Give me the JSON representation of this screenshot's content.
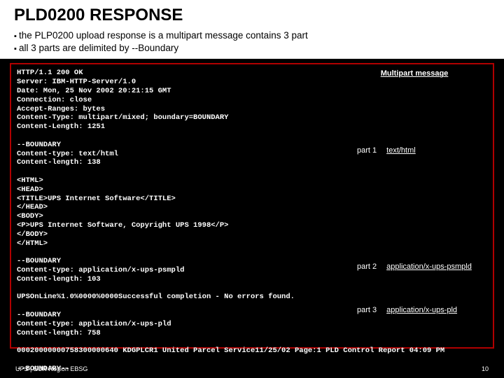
{
  "title": "PLD0200 RESPONSE",
  "bullets": [
    "the PLP0200 upload response is a multipart message contains 3 part",
    "all 3 parts are delimited by --Boundary"
  ],
  "labels": {
    "header": "Multipart message",
    "p1": {
      "part": "part 1",
      "type": "text/html"
    },
    "p2": {
      "part": "part 2",
      "type": "application/x-ups-psmpld"
    },
    "p3": {
      "part": "part 3",
      "type": "application/x-ups-pld"
    }
  },
  "code": "HTTP/1.1 200 OK\nServer: IBM-HTTP-Server/1.0\nDate: Mon, 25 Nov 2002 20:21:15 GMT\nConnection: close\nAccept-Ranges: bytes\nContent-Type: multipart/mixed; boundary=BOUNDARY\nContent-Length: 1251\n\n--BOUNDARY\nContent-type: text/html\nContent-length: 138\n\n<HTML>\n<HEAD>\n<TITLE>UPS Internet Software</TITLE>\n</HEAD>\n<BODY>\n<P>UPS Internet Software, Copyright UPS 1998</P>\n</BODY>\n</HTML>\n\n--BOUNDARY\nContent-type: application/x-ups-psmpld\nContent-length: 103\n\nUPSOnLine%1.0%0000%0000Successful completion - No errors found.\n\n--BOUNDARY\nContent-type: application/x-ups-pld\nContent-length: 758\n\n00020000000758300000640 KDGPLCR1 United Parcel Service11/25/02 Page:1 PLD Control Report 04:09 PM\n\n--BOUNDARY--",
  "footer": {
    "left": "UPS | EUR Region EBSG",
    "right": "10"
  }
}
